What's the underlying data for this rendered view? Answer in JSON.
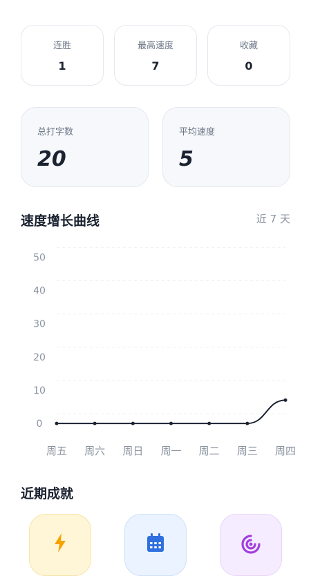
{
  "stats": [
    {
      "label": "连胜",
      "value": "1"
    },
    {
      "label": "最高速度",
      "value": "7"
    },
    {
      "label": "收藏",
      "value": "0"
    }
  ],
  "totals": [
    {
      "label": "总打字数",
      "value": "20"
    },
    {
      "label": "平均速度",
      "value": "5"
    }
  ],
  "chart_section": {
    "title": "速度增长曲线",
    "range": "近 7 天"
  },
  "chart_data": {
    "type": "line",
    "categories": [
      "周五",
      "周六",
      "周日",
      "周一",
      "周二",
      "周三",
      "周四"
    ],
    "values": [
      0,
      0,
      0,
      0,
      0,
      0,
      7
    ],
    "ylim": [
      -3.5,
      54
    ],
    "yticks": [
      0,
      10,
      20,
      30,
      40,
      50
    ],
    "grid": true,
    "line_color": "#1b2230"
  },
  "achievements": {
    "title": "近期成就",
    "items": [
      {
        "icon": "lightning-icon",
        "bg": "#fff6d8",
        "border": "#f6e4a6",
        "color": "#f5a300"
      },
      {
        "icon": "calendar-icon",
        "bg": "#eaf3ff",
        "border": "#cfe1f7",
        "color": "#2f6fe0"
      },
      {
        "icon": "target-icon",
        "bg": "#f6ecff",
        "border": "#e8d5f7",
        "color": "#a13fe0"
      }
    ]
  }
}
